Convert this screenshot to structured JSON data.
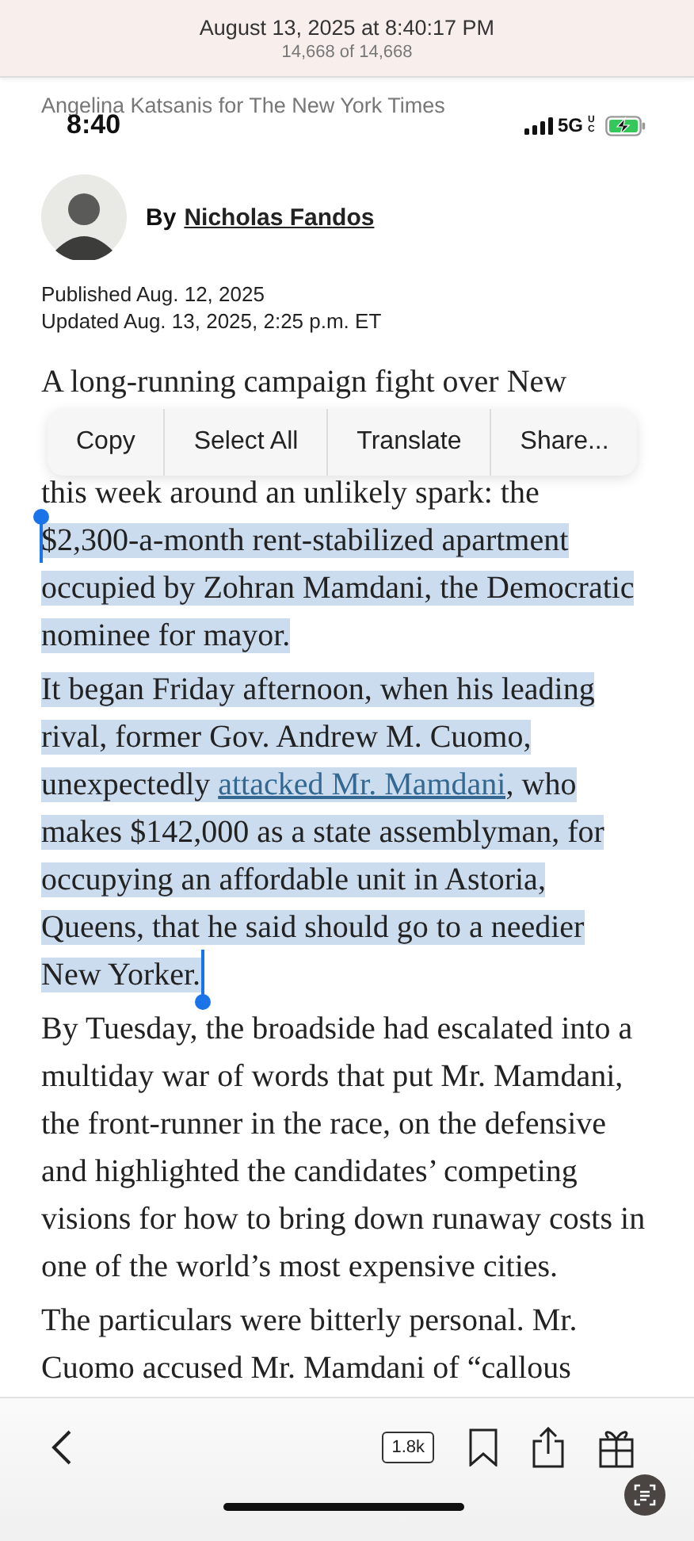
{
  "screenshot_banner": {
    "timestamp": "August 13, 2025 at 8:40:17 PM",
    "counter": "14,668 of 14,668"
  },
  "photo_credit": "Angelina Katsanis for The New York Times",
  "status_bar": {
    "time": "8:40",
    "network": "5G",
    "network_suffix": "UC",
    "battery_charging": true
  },
  "byline": {
    "prefix": "By",
    "author": "Nicholas Fandos"
  },
  "dates": [
    "Published Aug. 12, 2025",
    "Updated Aug. 13, 2025, 2:25 p.m. ET"
  ],
  "paragraphs": [
    {
      "segments": [
        {
          "kind": "text",
          "text": "A long-running campaign fight over New",
          "selected": false
        },
        {
          "kind": "covered_line"
        },
        {
          "kind": "text",
          "text": "this week around an unlikely spark: the ",
          "selected": false
        },
        {
          "kind": "text",
          "text": "$2,300-a-month rent-stabilized apartment occupied by Zohran Mamdani, the Democratic nominee for mayor.",
          "selected": true
        }
      ]
    },
    {
      "segments": [
        {
          "kind": "text",
          "text": "It began Friday afternoon, when his leading rival, former Gov. Andrew M. Cuomo, unexpectedly ",
          "selected": true
        },
        {
          "kind": "link",
          "text": "attacked Mr. Mamdani",
          "selected": true
        },
        {
          "kind": "text",
          "text": ", who makes $142,000 as a state assemblyman, for occupying an affordable unit in Astoria, Queens, that he said should go to a needier New Yorker.",
          "selected": true
        }
      ]
    },
    {
      "segments": [
        {
          "kind": "text",
          "text": "By Tuesday, the broadside had escalated into a multiday war of words that put Mr. Mamdani, the front-runner in the race, on the defensive and highlighted the candidates’ competing visions for how to bring down runaway costs in one of the world’s most expensive cities.",
          "selected": false
        }
      ]
    },
    {
      "segments": [
        {
          "kind": "text",
          "text": "The particulars were bitterly personal. Mr. Cuomo accused Mr. Mamdani of “callous",
          "selected": false
        }
      ]
    }
  ],
  "context_menu": [
    "Copy",
    "Select All",
    "Translate",
    "Share..."
  ],
  "toolbar": {
    "comment_count": "1.8k"
  }
}
